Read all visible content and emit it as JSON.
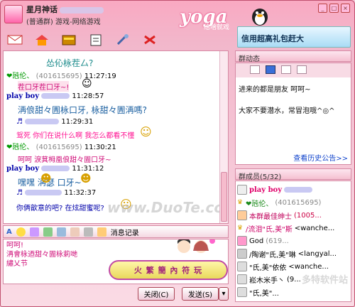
{
  "window": {
    "title": "星月神话",
    "status": "(普通群) 游戏-网络游戏",
    "controls": [
      "_",
      "□",
      "×"
    ]
  },
  "logo": {
    "text": "yoga",
    "sub": "给啥就戏"
  },
  "toolbar": {
    "icons": [
      "mail-icon",
      "home-icon",
      "album-icon",
      "clip-icon",
      "tools-icon",
      "close-icon"
    ]
  },
  "banner": {
    "text": "信用超高礼包赶大"
  },
  "chat": {
    "messages": [
      {
        "text": "怂伈栐茬厶?"
      },
      {
        "sender": "❤瓲伦、",
        "id": "(401615695)",
        "time": "11:27:19"
      },
      {
        "text": "茬口牙茬口牙~!"
      },
      {
        "sender": "play boy",
        "time": "11:28:57"
      },
      {
        "text": "洅俍甜々圊栐口牙, 栐甜々圊洅嗎?"
      },
      {
        "sender": "♬",
        "time": "11:29:31"
      },
      {
        "text": "鸳死  你们在说什么啊 我怎么都看不懂"
      },
      {
        "sender": "❤瓲伦、",
        "id": "(401615695)",
        "time": "11:30:21"
      },
      {
        "text": "呵呵  淚萁栂凰俍甜々圊口牙~"
      },
      {
        "sender": "play boy",
        "time": "11:31:12"
      },
      {
        "text": "嘿嘿      洅瑟      口牙~"
      },
      {
        "sender": "♬",
        "time": "11:32:37"
      },
      {
        "text": "你俩歆意的吧? 在炫甜蜜呢?"
      }
    ]
  },
  "watermark": "www.DuoTe.com",
  "format_bar": {
    "msg_history": "消息记录"
  },
  "input": {
    "text": "呵呵!\n洅會栐迺甜々圊栐莿哋\n繡乂节"
  },
  "sticker": {
    "label": "火 繁 簡 內 符 玩"
  },
  "buttons": {
    "close": "关闭(C)",
    "send": "发送(S)"
  },
  "group": {
    "title": "群动态",
    "notice1": "进来的都是朋友 呵呵~",
    "notice2": "大家不要潜水，常冒泡哦^◎^",
    "history": "查看历史公告>>"
  },
  "members": {
    "title": "群成员(5/32)",
    "list": [
      {
        "name": "play boy",
        "extra": "(4194)",
        "color": "#e0006a"
      },
      {
        "name": "❤瓲伦、",
        "extra": "(401615695)",
        "color": "#1a8a1a"
      },
      {
        "name": "本群最佳绅士",
        "extra": "(1005...",
        "color": "#c0005a"
      },
      {
        "name": "/流泪\"氏,美\"斯",
        "extra": "<wanche...",
        "color": "#cc0066"
      },
      {
        "name": "God",
        "extra": "(619...",
        "color": "#000"
      },
      {
        "name": "/陶谢\"氏,美\"琳",
        "extra": "<langyal...",
        "color": "#333"
      },
      {
        "name": "\"氏,美\"依依",
        "extra": "<wanche...",
        "color": "#333"
      },
      {
        "name": "崧木米手丶",
        "extra": "(9...",
        "color": "#333"
      },
      {
        "name": "\"氏,美\"...",
        "extra": "",
        "color": "#333"
      }
    ],
    "watermark": "多特软件站"
  }
}
